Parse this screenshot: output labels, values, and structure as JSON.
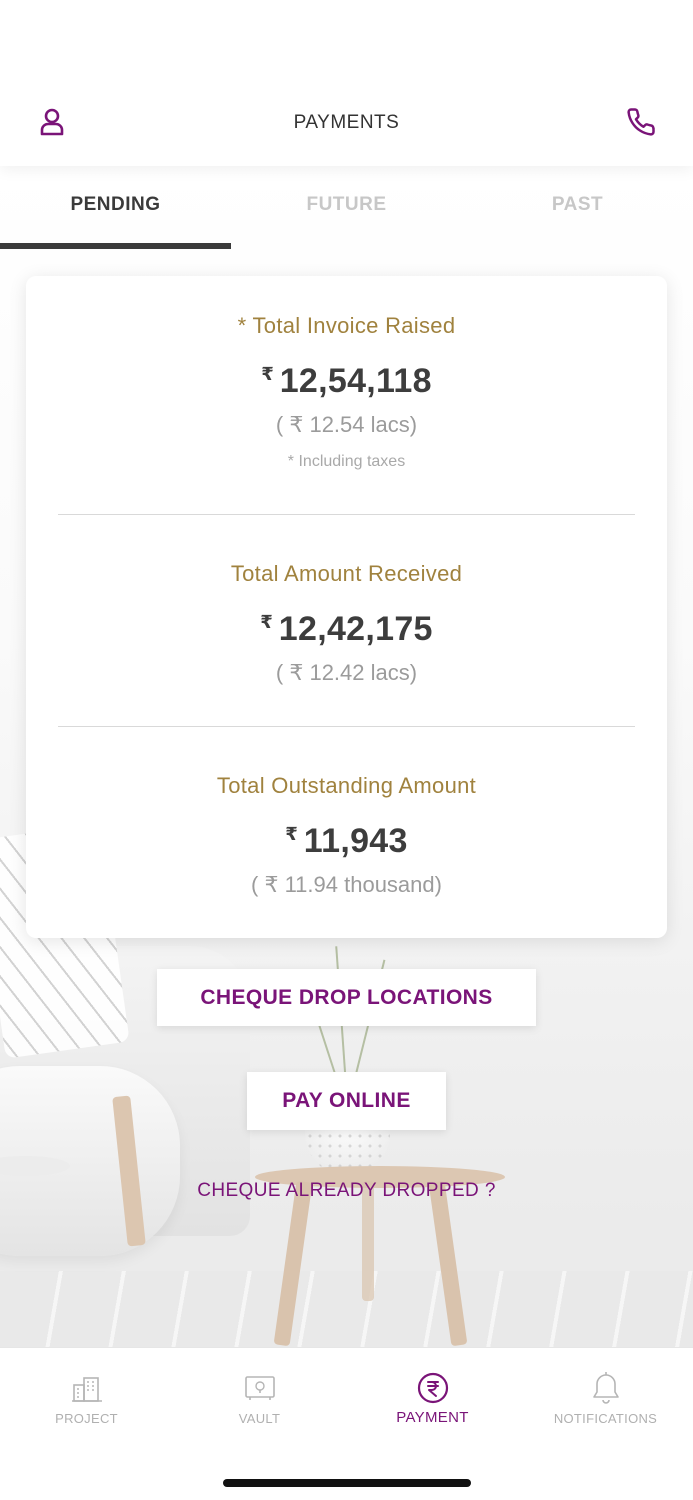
{
  "header": {
    "title": "PAYMENTS",
    "left_icon": "user-icon",
    "right_icon": "phone-icon"
  },
  "tabs": [
    {
      "label": "PENDING",
      "active": true
    },
    {
      "label": "FUTURE",
      "active": false
    },
    {
      "label": "PAST",
      "active": false
    }
  ],
  "summary": {
    "invoice": {
      "label": "* Total Invoice Raised",
      "currency": "₹",
      "amount": "12,54,118",
      "words": "( ₹ 12.54 lacs)",
      "note": "* Including taxes"
    },
    "received": {
      "label": "Total Amount Received",
      "currency": "₹",
      "amount": "12,42,175",
      "words": "( ₹ 12.42 lacs)"
    },
    "outstanding": {
      "label": "Total Outstanding Amount",
      "currency": "₹",
      "amount": "11,943",
      "words": "( ₹ 11.94 thousand)"
    }
  },
  "actions": {
    "cheque_drop_label": "CHEQUE DROP LOCATIONS",
    "pay_online_label": "PAY ONLINE",
    "cheque_dropped_label": "CHEQUE ALREADY DROPPED ?"
  },
  "bottom_nav": [
    {
      "label": "PROJECT",
      "icon": "building-icon",
      "active": false
    },
    {
      "label": "VAULT",
      "icon": "vault-icon",
      "active": false
    },
    {
      "label": "PAYMENT",
      "icon": "rupee-icon",
      "active": true
    },
    {
      "label": "NOTIFICATIONS",
      "icon": "bell-icon",
      "active": false
    }
  ],
  "colors": {
    "accent": "#7a1478",
    "gold": "#a0823e",
    "text_dark": "#3d3d3d",
    "text_muted": "#9b9b9b"
  }
}
